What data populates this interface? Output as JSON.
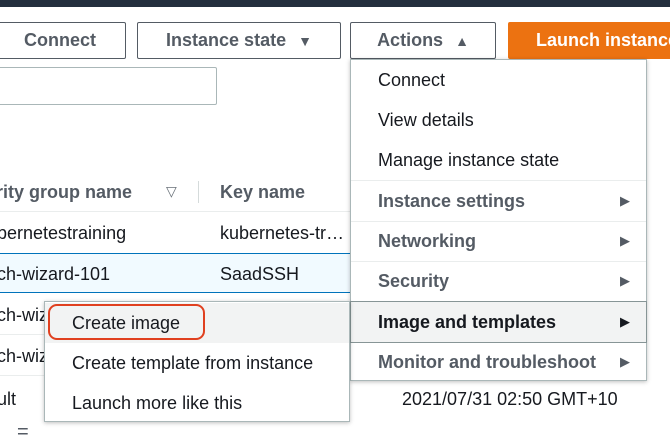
{
  "toolbar": {
    "connect_label": "Connect",
    "instance_state_label": "Instance state",
    "actions_label": "Actions",
    "launch_label": "Launch instances",
    "caret_down": "▼",
    "caret_up": "▲"
  },
  "search": {
    "value": ""
  },
  "table": {
    "columns": [
      "rity group name",
      "Key name"
    ],
    "sort_icon": "▽",
    "rows": [
      {
        "group": "bernetestraining",
        "key": "kubernetes-tr…"
      },
      {
        "group": "ch-wizard-101",
        "key": "SaadSSH"
      },
      {
        "group": "ch-wiz",
        "key": ""
      },
      {
        "group": "ch-wiz",
        "key": ""
      },
      {
        "group": "ult",
        "key": "2021/07/31 02:50 GMT+10"
      }
    ]
  },
  "actions_menu": {
    "items": [
      {
        "label": "Connect",
        "submenu": false
      },
      {
        "label": "View details",
        "submenu": false
      },
      {
        "label": "Manage instance state",
        "submenu": false
      },
      {
        "label": "Instance settings",
        "submenu": true
      },
      {
        "label": "Networking",
        "submenu": true
      },
      {
        "label": "Security",
        "submenu": true
      },
      {
        "label": "Image and templates",
        "submenu": true,
        "active": true
      },
      {
        "label": "Monitor and troubleshoot",
        "submenu": true
      }
    ],
    "arrow": "▶"
  },
  "image_submenu": {
    "items": [
      {
        "label": "Create image",
        "highlighted": true
      },
      {
        "label": "Create template from instance"
      },
      {
        "label": "Launch more like this"
      }
    ]
  },
  "footer": {
    "glyph": "="
  },
  "colors": {
    "accent_orange": "#ec7211",
    "annotation_red": "#e0401f",
    "selected_row": "#f1faff",
    "header_bar": "#232f3e"
  }
}
